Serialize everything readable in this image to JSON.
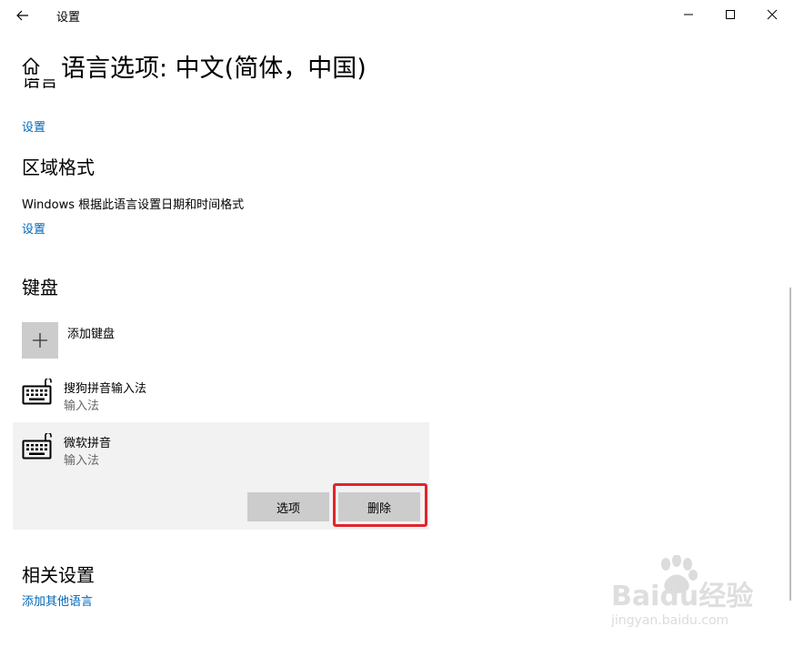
{
  "titlebar": {
    "title": "设置",
    "back_icon": "arrow-left-icon",
    "minimize_icon": "minimize-icon",
    "maximize_icon": "maximize-icon",
    "close_icon": "close-icon"
  },
  "header": {
    "home_icon": "home-icon",
    "title": "语言选项: 中文(简体，中国)"
  },
  "language_section": {
    "heading_partial": "语言",
    "settings_link": "设置"
  },
  "region_section": {
    "heading": "区域格式",
    "description": "Windows 根据此语言设置日期和时间格式",
    "settings_link": "设置"
  },
  "keyboard_section": {
    "heading": "键盘",
    "add_keyboard_label": "添加键盘",
    "keyboards": [
      {
        "name": "搜狗拼音输入法",
        "type": "输入法",
        "icon": "keyboard-icon"
      },
      {
        "name": "微软拼音",
        "type": "输入法",
        "icon": "keyboard-icon",
        "selected": true
      }
    ],
    "options_button": "选项",
    "remove_button": "删除"
  },
  "related_section": {
    "heading": "相关设置",
    "add_language_link": "添加其他语言"
  },
  "watermark": {
    "logo_text": "Baidu经验",
    "url": "jingyan.baidu.com"
  },
  "colors": {
    "accent_link": "#0067b8",
    "selected_bg": "#f2f2f2",
    "button_bg": "#cccccc",
    "highlight_border": "#e3242b"
  }
}
